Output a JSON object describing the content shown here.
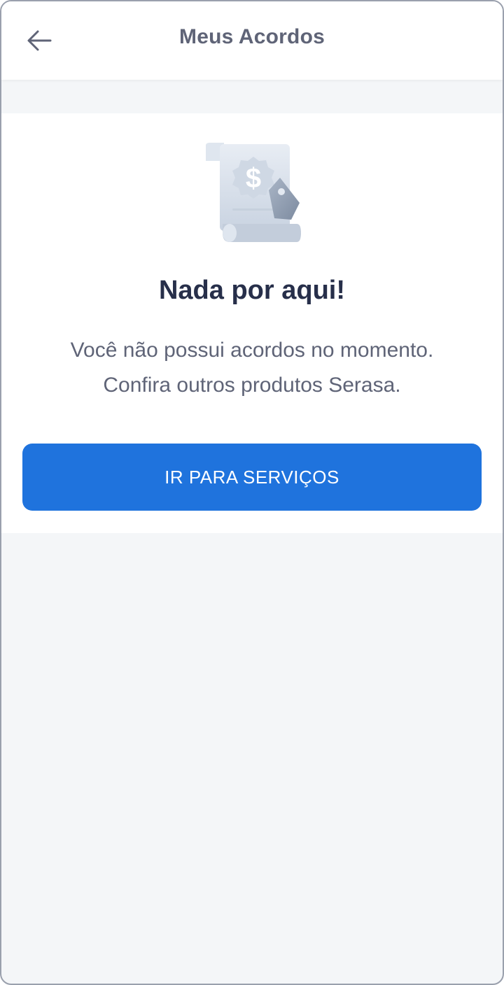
{
  "header": {
    "back_icon": "arrow-left-icon",
    "title": "Meus Acordos"
  },
  "empty_state": {
    "illustration_icon": "receipt-dollar-tag-icon",
    "title": "Nada por aqui!",
    "message_line1": "Você não possui acordos no momento.",
    "message_line2": "Confira outros produtos Serasa."
  },
  "cta": {
    "label": "IR PARA SERVIÇOS"
  },
  "colors": {
    "accent": "#1f73dd",
    "title_text": "#272f4a",
    "body_text": "#5f6477",
    "background": "#f4f6f8"
  }
}
